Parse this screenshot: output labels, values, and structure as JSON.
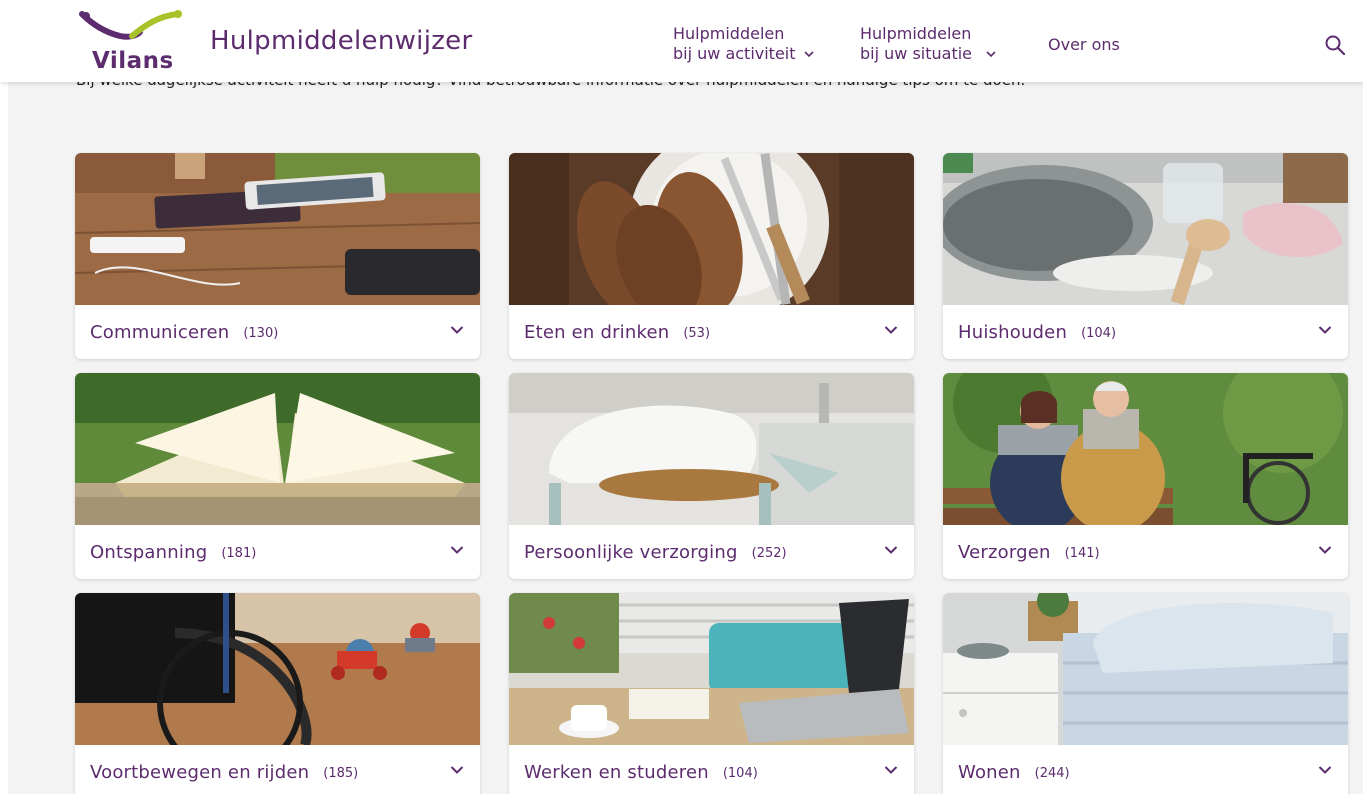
{
  "header": {
    "logo_text": "Vilans",
    "site_title": "Hulpmiddelenwijzer",
    "nav": [
      {
        "line1": "Hulpmiddelen",
        "line2": "bij uw activiteit"
      },
      {
        "line1": "Hulpmiddelen",
        "line2": "bij uw situatie"
      }
    ],
    "nav_about": "Over ons"
  },
  "intro": {
    "text": "Bij welke dagelijkse activiteit heeft u hulp nodig? Vind betrouwbare informatie over hulpmiddelen en handige tips om te doen."
  },
  "categories": [
    {
      "label": "Communiceren",
      "count": "(130)"
    },
    {
      "label": "Eten en drinken",
      "count": "(53)"
    },
    {
      "label": "Huishouden",
      "count": "(104)"
    },
    {
      "label": "Ontspanning",
      "count": "(181)"
    },
    {
      "label": "Persoonlijke verzorging",
      "count": "(252)"
    },
    {
      "label": "Verzorgen",
      "count": "(141)"
    },
    {
      "label": "Voortbewegen en rijden",
      "count": "(185)"
    },
    {
      "label": "Werken en studeren",
      "count": "(104)"
    },
    {
      "label": "Wonen",
      "count": "(244)"
    }
  ],
  "colors": {
    "brand_purple": "#5c2c6e",
    "brand_green": "#a8c32a",
    "background": "#f3f3f3"
  },
  "icons": {
    "search": "search-icon",
    "chevron": "chevron-down-icon"
  }
}
